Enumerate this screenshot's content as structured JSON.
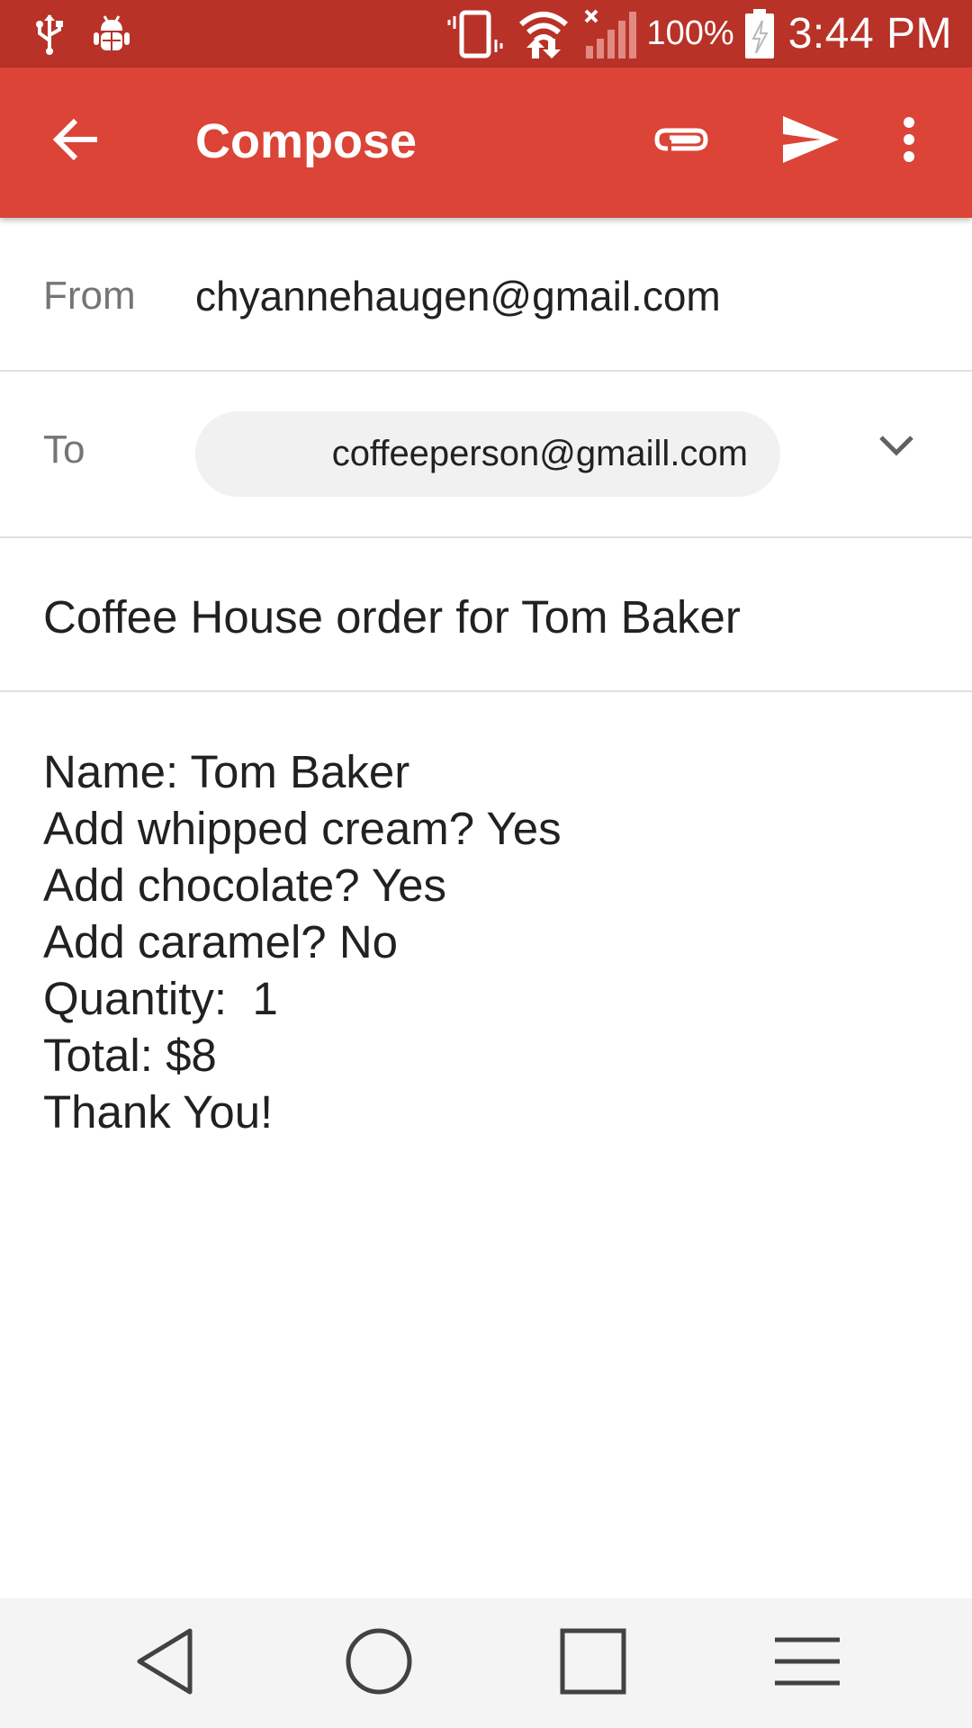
{
  "status_bar": {
    "battery_percent": "100%",
    "time": "3:44 PM",
    "icons": [
      "usb-icon",
      "android-debug-icon",
      "vibrate-icon",
      "wifi-icon",
      "signal-icon",
      "battery-charging-icon"
    ]
  },
  "app_bar": {
    "title": "Compose",
    "icons": [
      "arrow-back-icon",
      "paperclip-icon",
      "send-icon",
      "more-vert-icon"
    ]
  },
  "from": {
    "label": "From",
    "value": "chyannehaugen@gmail.com"
  },
  "to": {
    "label": "To",
    "recipient": "coffeeperson@gmaill.com"
  },
  "subject": "Coffee House order for Tom Baker",
  "body": {
    "lines": [
      "Name: Tom Baker",
      "Add whipped cream? Yes",
      "Add chocolate? Yes",
      "Add caramel? No",
      "Quantity:  1",
      "Total: $8",
      "Thank You!"
    ]
  },
  "nav_bar": {
    "icons": [
      "nav-back-icon",
      "nav-home-icon",
      "nav-recents-icon",
      "nav-menu-icon"
    ]
  },
  "colors": {
    "status_bar": "#b83228",
    "app_bar": "#db4437",
    "chip_bg": "#f1f1f1",
    "nav_bar_bg": "#f4f4f4"
  }
}
